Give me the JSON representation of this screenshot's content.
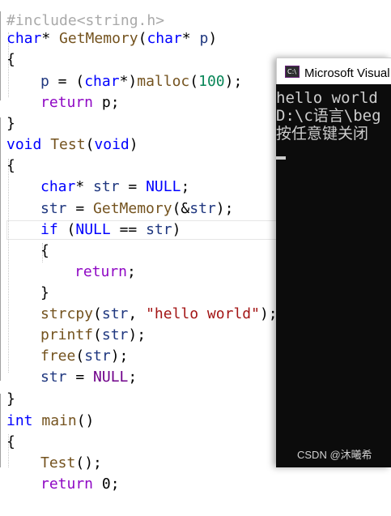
{
  "editor": {
    "line0": "#include<string.h>",
    "l1": {
      "type": "char",
      "ptr": "* ",
      "name": "GetMemory",
      "open": "(",
      "ptype": "char",
      "pstar": "* ",
      "pname": "p",
      "close": ")"
    },
    "brace_open": "{",
    "brace_close": "}",
    "l3": {
      "lhs": "p",
      "eq": " = (",
      "type": "char",
      "rest": "*)",
      "fn": "malloc",
      "open": "(",
      "num": "100",
      "end": ");"
    },
    "l4": {
      "kw": "return",
      "rest": " p;"
    },
    "l6": {
      "type": "void",
      "name": "Test",
      "open": "(",
      "arg": "void",
      "close": ")"
    },
    "l8": {
      "type": "char",
      "star": "* ",
      "var": "str",
      "eq": " = ",
      "val": "NULL",
      "end": ";"
    },
    "l9": {
      "var": "str",
      "eq": " = ",
      "fn": "GetMemory",
      "open": "(&",
      "arg": "str",
      "end": ");"
    },
    "l10": {
      "kw": "if",
      "sp": " (",
      "val": "NULL",
      "op": " == ",
      "var": "str",
      "end": ")"
    },
    "l12": {
      "kw": "return",
      "end": ";"
    },
    "l14": {
      "fn": "strcpy",
      "open": "(",
      "var": "str",
      "sep": ", ",
      "str": "\"hello world\"",
      "end": ");"
    },
    "l15": {
      "fn": "printf",
      "open": "(",
      "var": "str",
      "end": ");"
    },
    "l16": {
      "fn": "free",
      "open": "(",
      "var": "str",
      "end": ");"
    },
    "l17": {
      "var": "str",
      "eq": " = ",
      "val": "NULL",
      "end": ";"
    },
    "l19": {
      "type": "int",
      "name": "main",
      "paren": "()"
    },
    "l21": {
      "fn": "Test",
      "end": "();"
    },
    "l22": {
      "kw": "return",
      "rest": " 0;"
    }
  },
  "console": {
    "title": "Microsoft Visual Studio 调试控制台",
    "icon_text": "C:\\",
    "lines": [
      "hello world",
      "D:\\c语言\\beg",
      "按任意键关闭"
    ]
  },
  "watermark": "CSDN @沐曦希",
  "colors": {
    "keyword": "#0000ff",
    "function": "#74531f",
    "string": "#a31515",
    "number": "#098658",
    "macro": "#6f008a",
    "console_bg": "#0c0c0c"
  }
}
